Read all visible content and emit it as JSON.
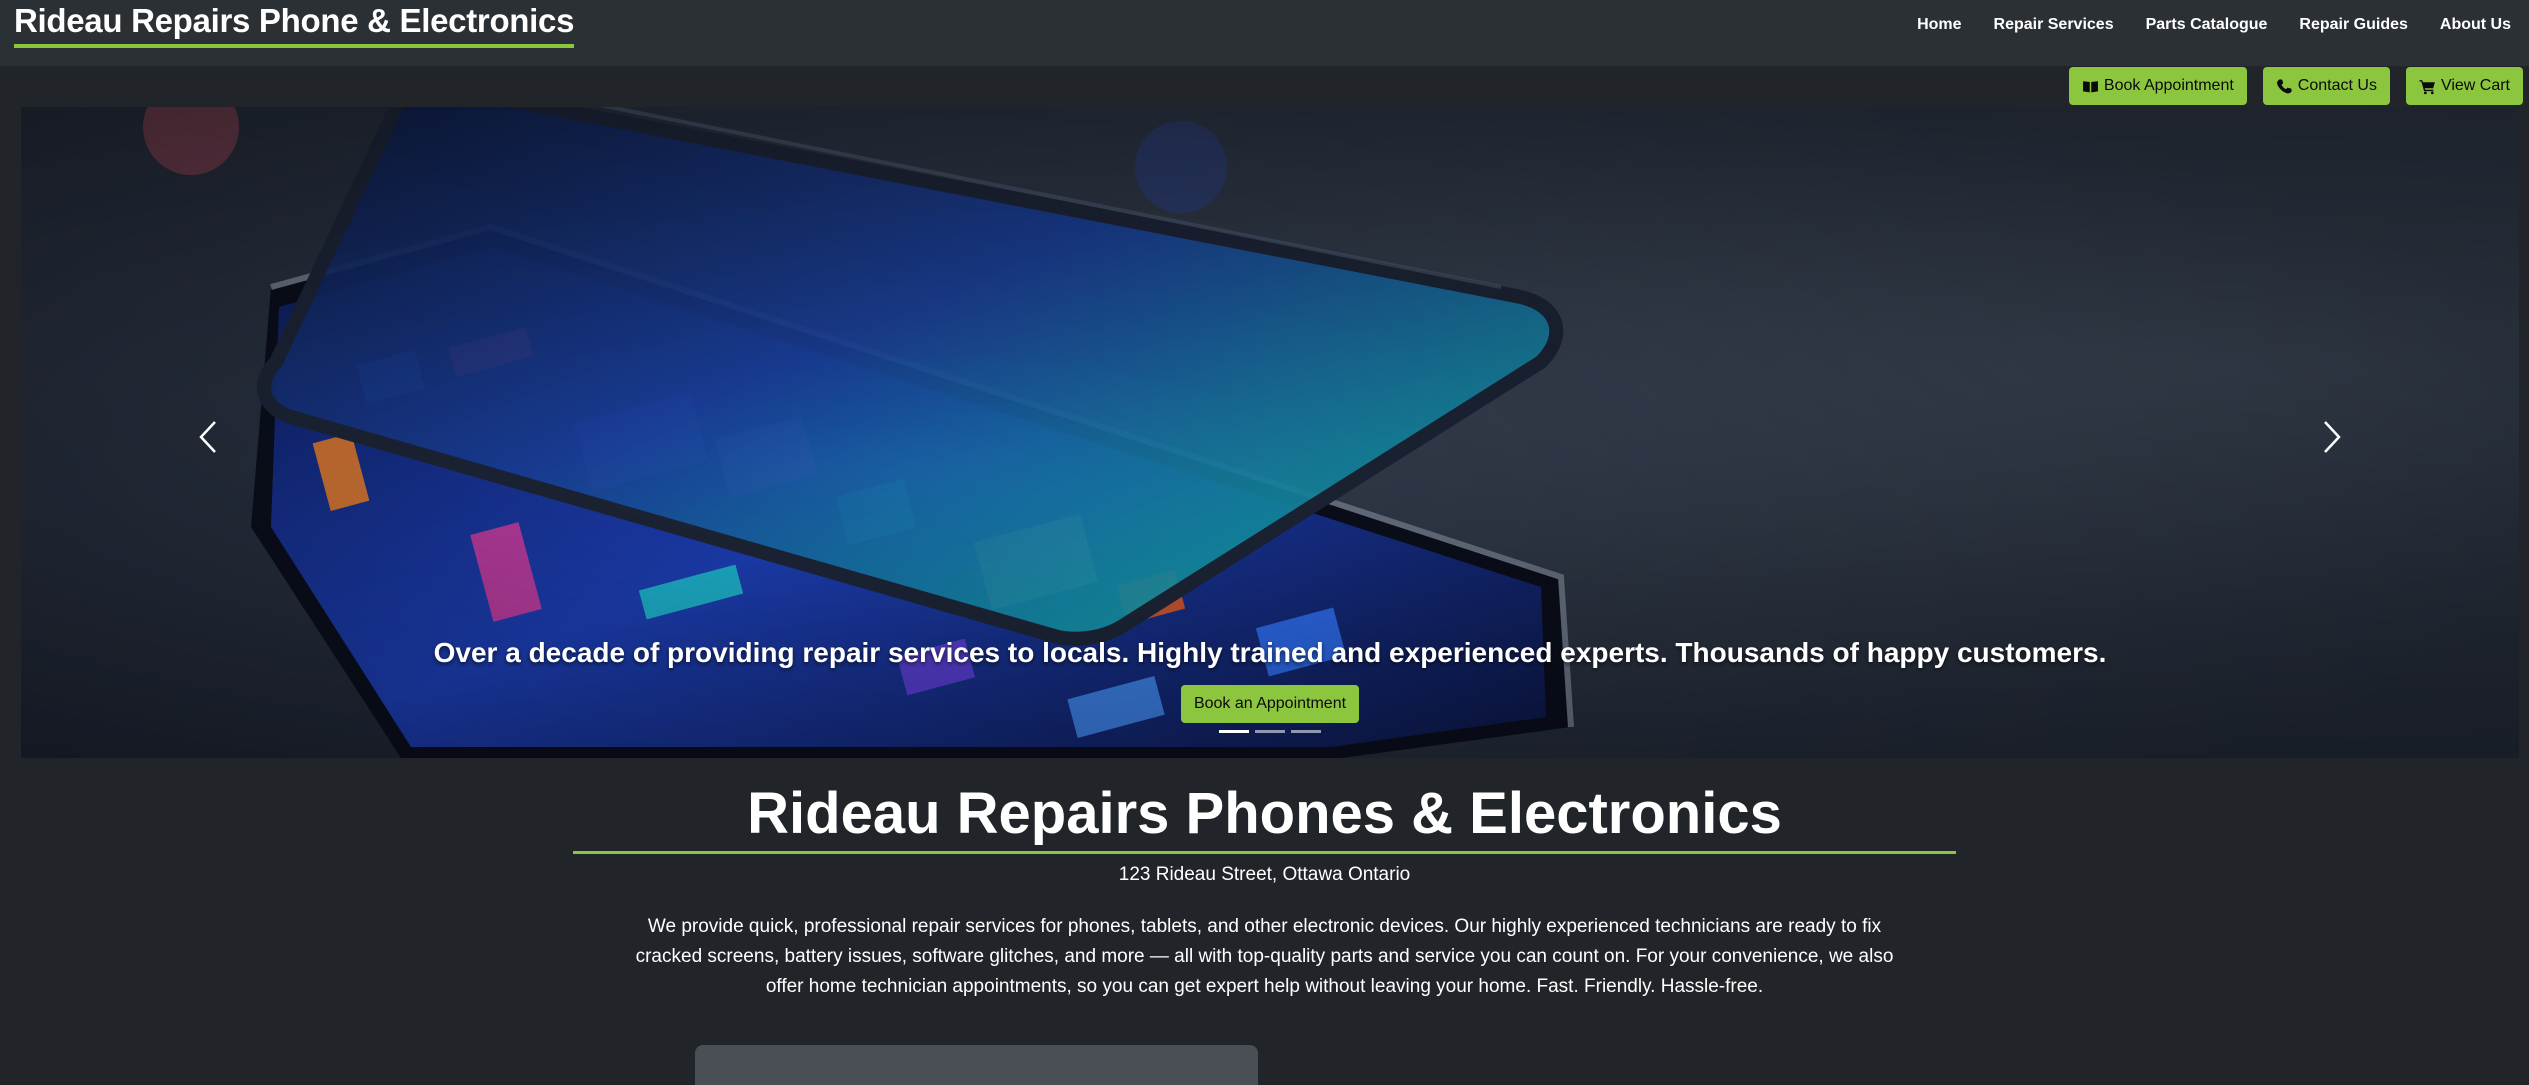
{
  "brand": "Rideau Repairs Phone & Electronics",
  "nav": {
    "home": "Home",
    "repair_services": "Repair Services",
    "parts_catalogue": "Parts Catalogue",
    "repair_guides": "Repair Guides",
    "about_us": "About Us"
  },
  "actions": {
    "book": "Book Appointment",
    "contact": "Contact Us",
    "cart": "View Cart"
  },
  "hero": {
    "caption": "Over a decade of providing repair services to locals. Highly trained and experienced experts. Thousands of happy customers.",
    "cta": "Book an Appointment",
    "slides": 3,
    "active_slide": 1
  },
  "intro": {
    "title": "Rideau Repairs Phones & Electronics",
    "address": "123 Rideau Street, Ottawa Ontario",
    "description": "We provide quick, professional repair services for phones, tablets, and other electronic devices. Our highly experienced technicians are ready to fix cracked screens, battery issues, software glitches, and more — all with top-quality parts and service you can count on. For your convenience, we also offer home technician appointments, so you can get expert help without leaving your home. Fast. Friendly. Hassle-free."
  },
  "colors": {
    "accent": "#8cc63f",
    "background": "#212529",
    "navbar": "#2b3035"
  },
  "icons": [
    "book-icon",
    "phone-icon",
    "cart-icon",
    "chevron-left-icon",
    "chevron-right-icon"
  ]
}
